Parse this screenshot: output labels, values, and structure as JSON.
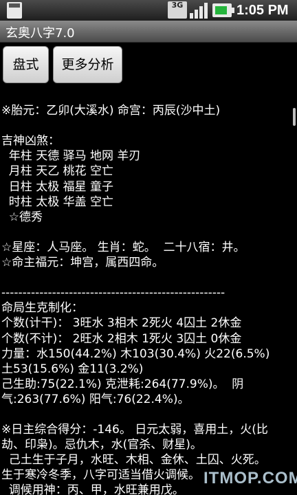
{
  "status_bar": {
    "network": "3G",
    "time": "1:05 PM",
    "icons": [
      "sd-card-icon",
      "network-3g-icon",
      "signal-icon",
      "battery-icon"
    ]
  },
  "app": {
    "title": "玄奥八字7.0"
  },
  "buttons": {
    "panshi": "盘式",
    "more_analysis": "更多分析"
  },
  "content": {
    "lines": [
      "",
      "※胎元：乙卯(大溪水) 命宫：丙辰(沙中土)",
      "",
      "吉神凶煞：",
      "  年柱 天德 驿马 地网 羊刃",
      "  月柱 天乙 桃花 空亡",
      "  日柱 太极 福星 童子",
      "  时柱 太极 华盖 空亡",
      "  ☆德秀",
      "",
      "☆星座：人马座。 生肖：蛇。  二十八宿：井。",
      "☆命主福元：坤宫，属西四命。",
      "",
      "-----------------------------------------------------",
      "命局生克制化：",
      "个数(计干)： 3旺水 3相木 2死火 4囚土 2休金",
      "个数(不计)： 2旺水 2相木 1死火 3囚土 0休金",
      "力量：水150(44.2%) 木103(30.4%) 火22(6.5%)",
      "土53(15.6%) 金11(3.2%)",
      "己生助:75(22.1%) 克泄耗:264(77.9%)。  阴",
      "气:263(77.6%) 阳气:76(22.4%)。",
      "",
      "※日主综合得分：-146。 日元太弱，喜用土，火(比",
      "劫、印枭)。忌仇木，水(官杀、财星)。",
      "  己土生于子月，水旺、木相、金休、土囚、火死。",
      "生于寒冷冬季，八字可适当借火调候。",
      "  调候用神：丙、甲，水旺兼用戊。"
    ]
  },
  "watermark": "ITMOP.COM"
}
